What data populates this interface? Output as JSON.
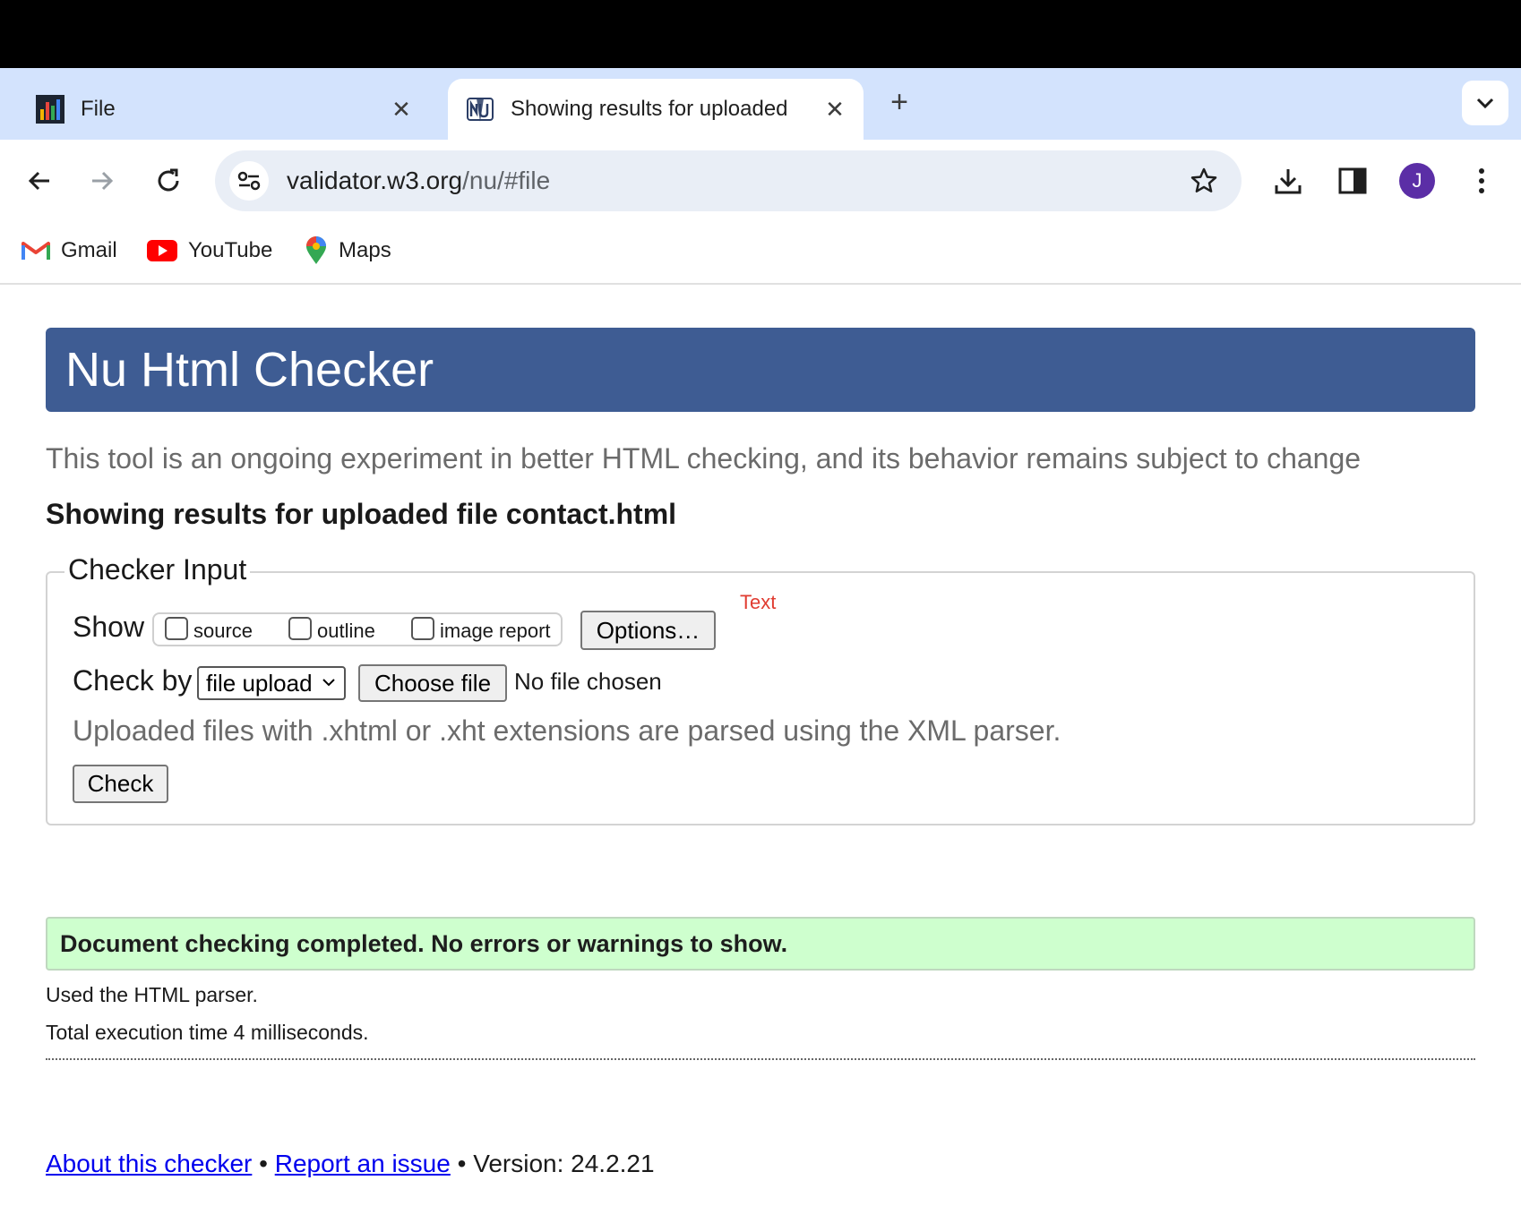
{
  "browser": {
    "tabs": [
      {
        "title": "File",
        "active": false
      },
      {
        "title": "Showing results for uploaded",
        "active": true
      }
    ],
    "address": {
      "host": "validator.w3.org",
      "path": "/nu/#file"
    },
    "avatar_letter": "J",
    "bookmarks": [
      {
        "label": "Gmail",
        "icon": "gmail-icon"
      },
      {
        "label": "YouTube",
        "icon": "youtube-icon"
      },
      {
        "label": "Maps",
        "icon": "maps-icon"
      }
    ]
  },
  "page": {
    "banner_title": "Nu Html Checker",
    "intro": "This tool is an ongoing experiment in better HTML checking, and its behavior remains subject to change",
    "results_heading": "Showing results for uploaded file contact.html",
    "checker_input": {
      "legend": "Checker Input",
      "show_label": "Show",
      "checkboxes": [
        "source",
        "outline",
        "image report"
      ],
      "options_button": "Options…",
      "annotation": "Text",
      "check_by_label": "Check by",
      "check_by_value": "file upload",
      "choose_file_button": "Choose file",
      "no_file_text": "No file chosen",
      "xhtml_note": "Uploaded files with .xhtml or .xht extensions are parsed using the XML parser.",
      "check_button": "Check"
    },
    "success_message": "Document checking completed. No errors or warnings to show.",
    "parser_note": "Used the HTML parser.",
    "execution_time": "Total execution time 4 milliseconds.",
    "footer": {
      "about_link": "About this checker",
      "separator": "•",
      "report_link": "Report an issue",
      "version": "Version: 24.2.21"
    }
  },
  "colors": {
    "banner": "#3e5c93",
    "success_bg": "#ccffcc",
    "annotation": "#e03c31",
    "tabstrip": "#d3e3fd",
    "avatar": "#5b2ea6"
  }
}
